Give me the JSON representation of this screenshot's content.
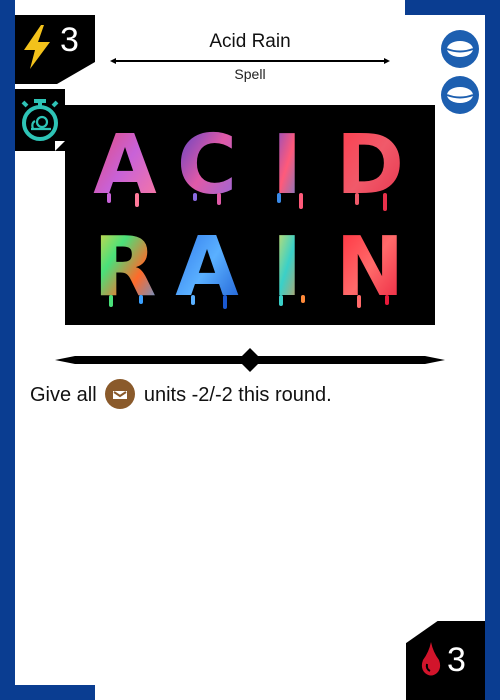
{
  "card": {
    "title": "Acid Rain",
    "type": "Spell",
    "cost": "3",
    "health": "3",
    "rules": {
      "prefix": "Give all",
      "suffix": "units -2/-2 this round."
    }
  },
  "icons": {
    "cost": "lightning-bolt-icon",
    "speed": "snail-stopwatch-icon",
    "tokens": [
      "token-disc-icon",
      "token-disc-icon"
    ],
    "faction": "faction-emblem-icon",
    "health": "blood-drop-icon"
  },
  "art": {
    "line1": "ACID",
    "line2": "RAIN"
  },
  "colors": {
    "frame": "#0a3d91",
    "bolt": "#f3c21b",
    "speed_icon": "#2ec4b6",
    "token": "#1d5fb0",
    "faction": "#8a5a2b",
    "drop": "#d2142b"
  }
}
